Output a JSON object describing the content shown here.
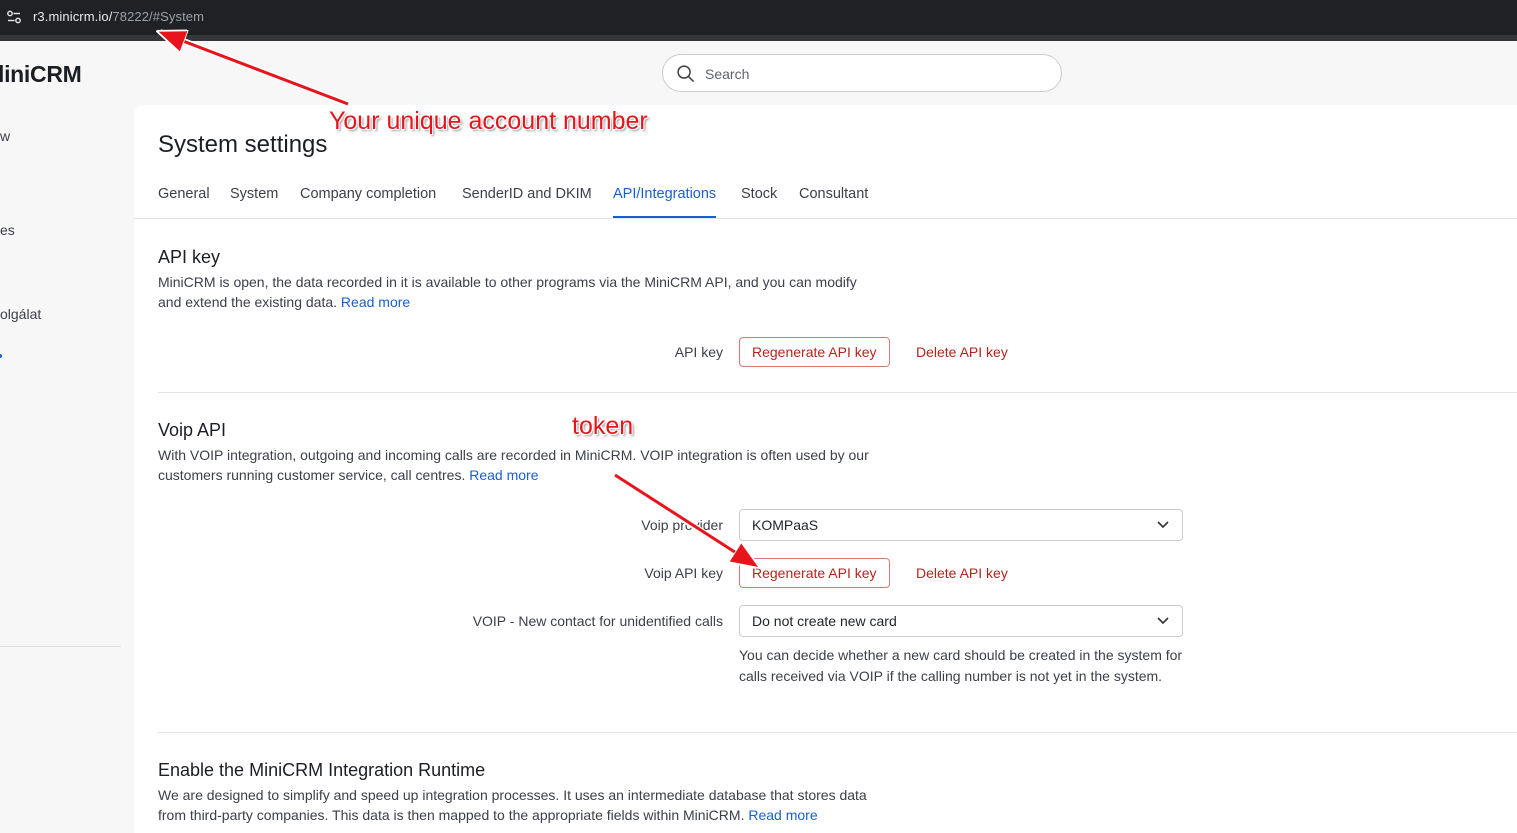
{
  "browser": {
    "url_host": "r3.minicrm.io/",
    "url_path": "78222/#System"
  },
  "sidebar": {
    "logo": "liniCRM",
    "items": [
      {
        "label": "w"
      },
      {
        "label": "es"
      },
      {
        "label": "olgálat"
      }
    ]
  },
  "search": {
    "placeholder": "Search"
  },
  "page": {
    "title": "System settings",
    "tabs": [
      {
        "label": "General"
      },
      {
        "label": "System"
      },
      {
        "label": "Company completion"
      },
      {
        "label": "SenderID and DKIM"
      },
      {
        "label": "API/Integrations",
        "active": true
      },
      {
        "label": "Stock"
      },
      {
        "label": "Consultant"
      }
    ]
  },
  "api_key": {
    "title": "API key",
    "desc": "MiniCRM is open, the data recorded in it is available to other programs via the MiniCRM API, and you can modify and extend the existing data.",
    "read_more": "Read more",
    "field_label": "API key",
    "regenerate": "Regenerate API key",
    "delete": "Delete API key"
  },
  "voip": {
    "title": "Voip API",
    "desc": "With VOIP integration, outgoing and incoming calls are recorded in MiniCRM. VOIP integration is often used by our customers running customer service, call centres.",
    "read_more": "Read more",
    "provider_label": "Voip provider",
    "provider_value": "KOMPaaS",
    "key_label": "Voip API key",
    "regenerate": "Regenerate API key",
    "delete": "Delete API key",
    "new_contact_label": "VOIP - New contact for unidentified calls",
    "new_contact_value": "Do not create new card",
    "help": "You can decide whether a new card should be created in the system for calls received via VOIP if the calling number is not yet in the system."
  },
  "runtime": {
    "title": "Enable the MiniCRM Integration Runtime",
    "desc": "We are designed to simplify and speed up integration processes. It uses an intermediate database that stores data from third-party companies. This data is then mapped to the appropriate fields within MiniCRM.",
    "read_more": "Read more"
  },
  "annotations": {
    "account_number": "Your unique account number",
    "token": "token",
    "color": "#e8141b"
  },
  "colors": {
    "accent": "#1a5fd0",
    "danger": "#b3261e",
    "browser_bar": "#202124"
  }
}
